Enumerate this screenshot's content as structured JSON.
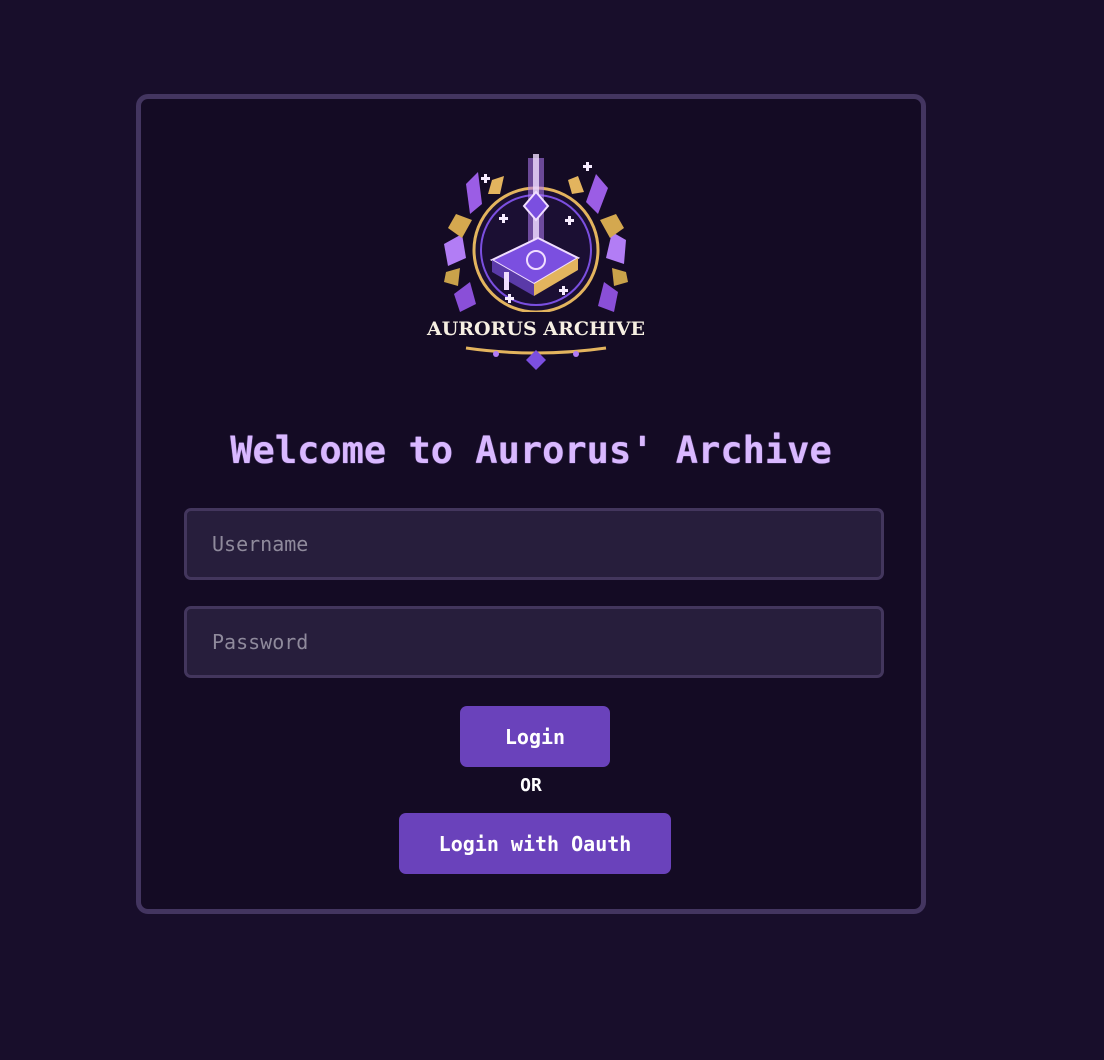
{
  "logo": {
    "text": "AURORUS ARCHIVE",
    "colors": {
      "purple": "#7b4fe0",
      "gold": "#e3b45e",
      "crystal": "#b27df5",
      "leaf": "#c9a24a"
    }
  },
  "welcome": {
    "title": "Welcome to Aurorus' Archive"
  },
  "form": {
    "username_placeholder": "Username",
    "username_value": "",
    "password_placeholder": "Password",
    "password_value": "",
    "login_label": "Login",
    "or_label": "OR",
    "oauth_label": "Login with Oauth"
  },
  "colors": {
    "page_bg": "#180e2b",
    "card_border": "#433560",
    "title": "#d9b8ff",
    "button": "#6a42bb",
    "input_bg": "#271e3c"
  }
}
